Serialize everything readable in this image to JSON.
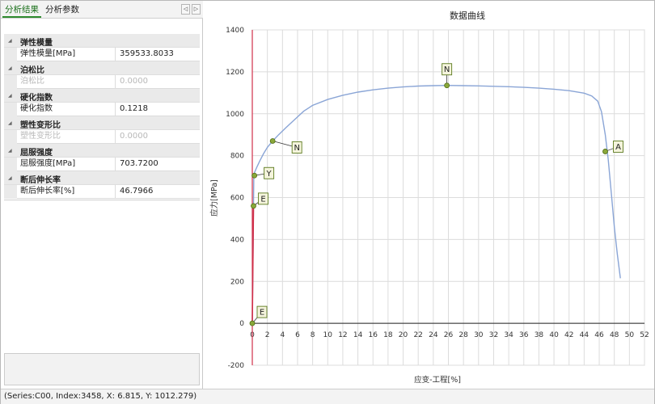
{
  "tabs": [
    {
      "label": "分析结果",
      "active": true
    },
    {
      "label": "分析参数",
      "active": false
    }
  ],
  "nav": {
    "left": "◁",
    "right": "▷"
  },
  "categories": [
    {
      "title": "弹性模量",
      "row": {
        "key": "弹性模量[MPa]",
        "value": "359533.8033",
        "disabled": false
      }
    },
    {
      "title": "泊松比",
      "row": {
        "key": "泊松比",
        "value": "0.0000",
        "disabled": true
      }
    },
    {
      "title": "硬化指数",
      "row": {
        "key": "硬化指数",
        "value": "0.1218",
        "disabled": false
      }
    },
    {
      "title": "塑性变形比",
      "row": {
        "key": "塑性变形比",
        "value": "0.0000",
        "disabled": true
      }
    },
    {
      "title": "屈服强度",
      "row": {
        "key": "屈服强度[MPa]",
        "value": "703.7200",
        "disabled": false
      }
    },
    {
      "title": "断后伸长率",
      "row": {
        "key": "断后伸长率[%]",
        "value": "46.7966",
        "disabled": false
      }
    }
  ],
  "status": {
    "text": "(Series:C00, Index:3458, X: 6.815, Y: 1012.279)"
  },
  "chart_data": {
    "type": "line",
    "title": "数据曲线",
    "xlabel": "应变-工程[%]",
    "ylabel": "应力[MPa]",
    "xlim": [
      0,
      52
    ],
    "ylim": [
      -200,
      1400
    ],
    "xticks": [
      0,
      2,
      4,
      6,
      8,
      10,
      12,
      14,
      16,
      18,
      20,
      22,
      24,
      26,
      28,
      30,
      32,
      34,
      36,
      38,
      40,
      42,
      44,
      46,
      48,
      50,
      52
    ],
    "yticks": [
      -200,
      0,
      200,
      400,
      600,
      800,
      1000,
      1200,
      1400
    ],
    "grid": true,
    "colors": {
      "curve": "#8aa5d6",
      "elastic": "#d0304a",
      "marker": "#8aa83a",
      "markerStroke": "#4e6b14",
      "gridline": "#dcdcdc",
      "axis": "#222222"
    },
    "series": [
      {
        "x": [
          0.0,
          0.16,
          0.2,
          0.3,
          0.6,
          1.0,
          1.5,
          2.0,
          2.7,
          3.5,
          4.5,
          6.0,
          6.815,
          8.0,
          10.0,
          12.0,
          14.0,
          16.0,
          18.0,
          20.0,
          22.0,
          24.0,
          25.8,
          28.0,
          30.0,
          32.0,
          34.0,
          36.0,
          38.0,
          40.0,
          42.0,
          44.0,
          45.0,
          45.8,
          46.3,
          46.8,
          47.2,
          47.6,
          48.0,
          48.4,
          48.8
        ],
        "y": [
          0,
          570,
          705,
          720,
          745,
          775,
          810,
          840,
          870,
          900,
          935,
          985,
          1012.279,
          1040,
          1068,
          1088,
          1103,
          1114,
          1122,
          1128,
          1132,
          1134,
          1135,
          1134,
          1133,
          1131,
          1129,
          1126,
          1122,
          1117,
          1110,
          1098,
          1085,
          1060,
          1010,
          900,
          780,
          620,
          460,
          330,
          215
        ]
      },
      {
        "x": [
          0.0,
          0.16
        ],
        "y": [
          0,
          570
        ]
      }
    ],
    "markers": [
      {
        "label": "E",
        "x": 0.0,
        "y": 0
      },
      {
        "label": "E",
        "x": 0.16,
        "y": 560
      },
      {
        "label": "Y",
        "x": 0.28,
        "y": 705
      },
      {
        "label": "N",
        "x": 2.7,
        "y": 870
      },
      {
        "label": "N",
        "x": 25.8,
        "y": 1135
      },
      {
        "label": "A",
        "x": 46.8,
        "y": 820
      }
    ]
  }
}
